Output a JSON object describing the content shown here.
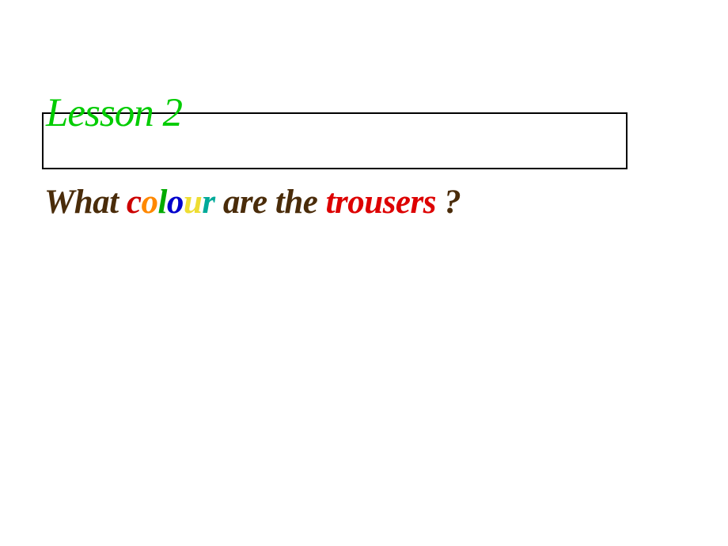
{
  "lesson": {
    "title": "Lesson 2"
  },
  "question": {
    "word_what": "What ",
    "colour": {
      "c": "c",
      "o": "o",
      "l": "l",
      "o2": "o",
      "u": "u",
      "r": "r"
    },
    "word_are": " are ",
    "word_the": "the ",
    "trousers": "trousers",
    "space": " ",
    "qmark": "?"
  }
}
